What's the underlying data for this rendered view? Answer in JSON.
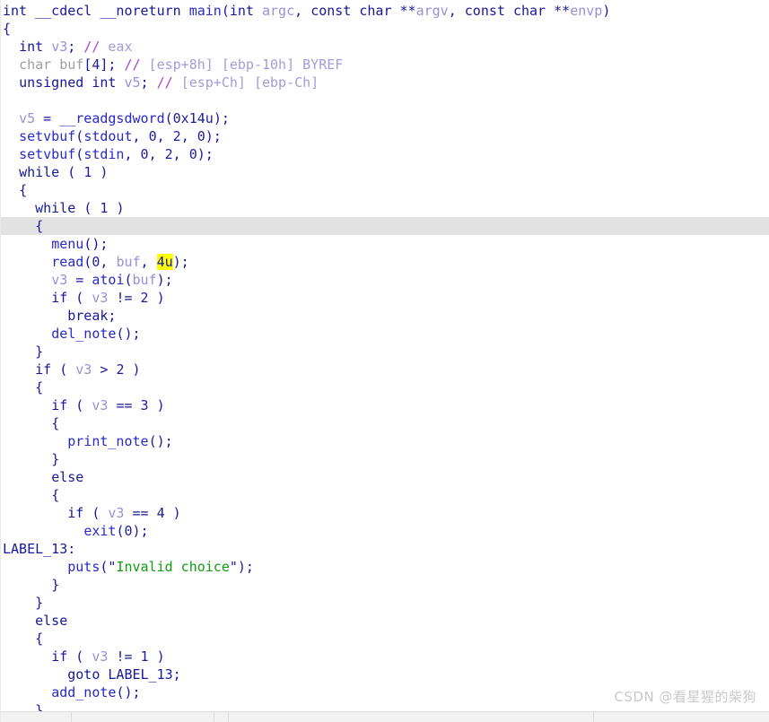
{
  "app": {
    "view_name": "Pseudocode",
    "watermark": "CSDN @看星猩的柴狗"
  },
  "editor": {
    "current_line_index": 12,
    "highlight_token": "4u",
    "colors": {
      "keyword": "#17179e",
      "function": "#2929cc",
      "local_variable": "#9a8fd8",
      "comment": "#a79ad9",
      "comment_slash": "#b03fd0",
      "string": "#109b10",
      "dim_type": "#9e9e9e",
      "current_line_bg": "#e2e2e2",
      "search_highlight_bg": "#ffff00",
      "background": "#ffffff"
    }
  },
  "code": {
    "language": "c",
    "function_signature": "int __cdecl __noreturn main(int argc, const char **argv, const char **envp)",
    "lines": [
      "int __cdecl __noreturn main(int argc, const char **argv, const char **envp)",
      "{",
      "  int v3; // eax",
      "  char buf[4]; // [esp+8h] [ebp-10h] BYREF",
      "  unsigned int v5; // [esp+Ch] [ebp-Ch]",
      "",
      "  v5 = __readgsdword(0x14u);",
      "  setvbuf(stdout, 0, 2, 0);",
      "  setvbuf(stdin, 0, 2, 0);",
      "  while ( 1 )",
      "  {",
      "    while ( 1 )",
      "    {",
      "      menu();",
      "      read(0, buf, 4u);",
      "      v3 = atoi(buf);",
      "      if ( v3 != 2 )",
      "        break;",
      "      del_note();",
      "    }",
      "    if ( v3 > 2 )",
      "    {",
      "      if ( v3 == 3 )",
      "      {",
      "        print_note();",
      "      }",
      "      else",
      "      {",
      "        if ( v3 == 4 )",
      "          exit(0);",
      "LABEL_13:",
      "        puts(\"Invalid choice\");",
      "      }",
      "    }",
      "    else",
      "    {",
      "      if ( v3 != 1 )",
      "        goto LABEL_13;",
      "      add_note();",
      "    }"
    ],
    "local_variables": [
      "v3",
      "buf",
      "v5"
    ],
    "called_functions": [
      "__readgsdword",
      "setvbuf",
      "menu",
      "read",
      "atoi",
      "del_note",
      "print_note",
      "exit",
      "puts",
      "add_note"
    ],
    "labels": [
      "LABEL_13"
    ],
    "string_literals": [
      "Invalid choice"
    ],
    "comments": [
      "// eax",
      "// [esp+8h] [ebp-10h] BYREF",
      "// [esp+Ch] [ebp-Ch]"
    ]
  }
}
